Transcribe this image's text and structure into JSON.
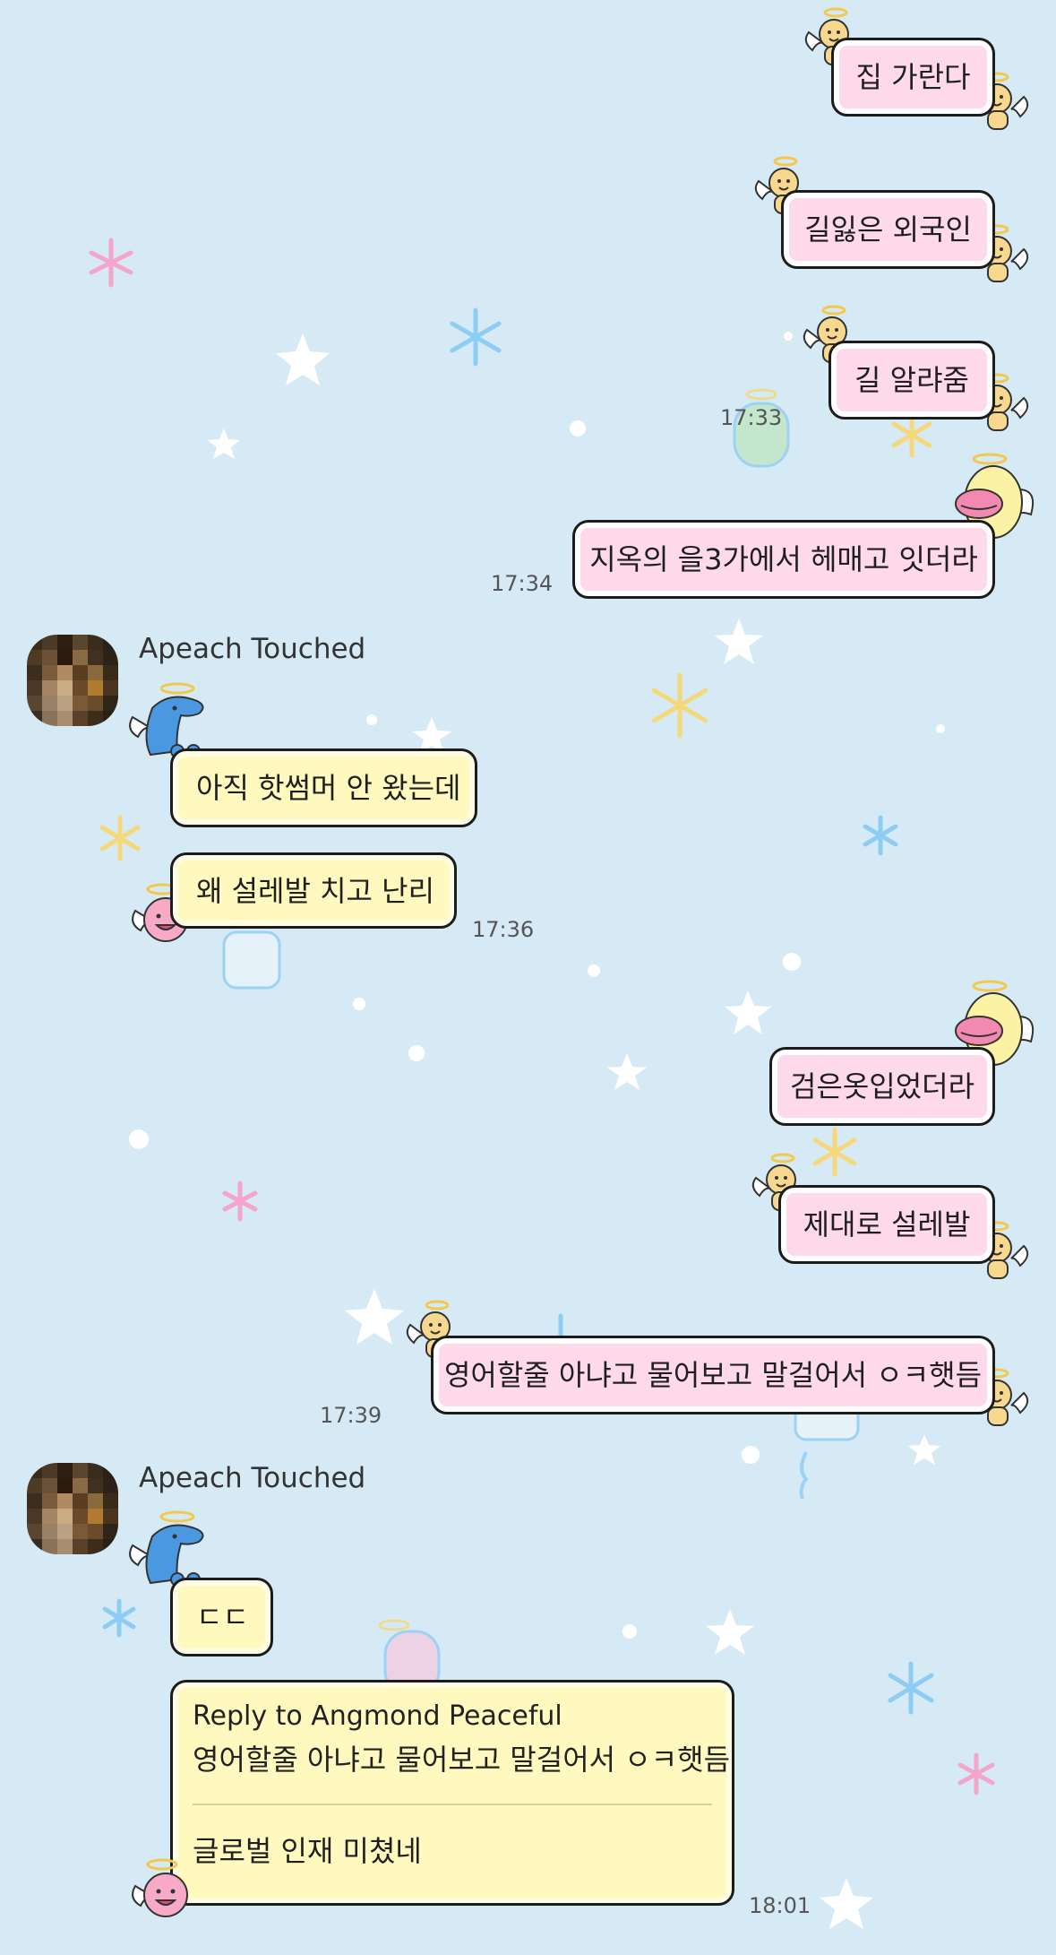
{
  "chat": {
    "messages": [
      {
        "text": "집 가란다"
      },
      {
        "text": "길잃은 외국인"
      },
      {
        "text": "길 알랴줌"
      },
      {
        "text": "지옥의 을3가에서 헤매고 잇더라"
      },
      {
        "text": "아직 핫썸머 안 왔는데"
      },
      {
        "text": "왜 설레발 치고 난리"
      },
      {
        "text": "검은옷입었더라"
      },
      {
        "text": "제대로 설레발"
      },
      {
        "text": "영어할줄 아냐고 물어보고 말걸어서 ㅇㅋ햇듬"
      },
      {
        "text": "ㄷㄷ"
      }
    ],
    "times": [
      "17:33",
      "17:34",
      "17:36",
      "17:39",
      "18:01"
    ],
    "sender_name": "Apeach Touched",
    "reply": {
      "title": "Reply to Angmond Peaceful",
      "quote": "영어할줄 아냐고 물어보고 말걸어서 ㅇㅋ햇듬",
      "body": "글로벌 인재 미쳤네"
    }
  },
  "colors": {
    "background": "#d6eaf6",
    "my_bubble": "#fdd9e9",
    "their_bubble": "#fff8bf"
  }
}
